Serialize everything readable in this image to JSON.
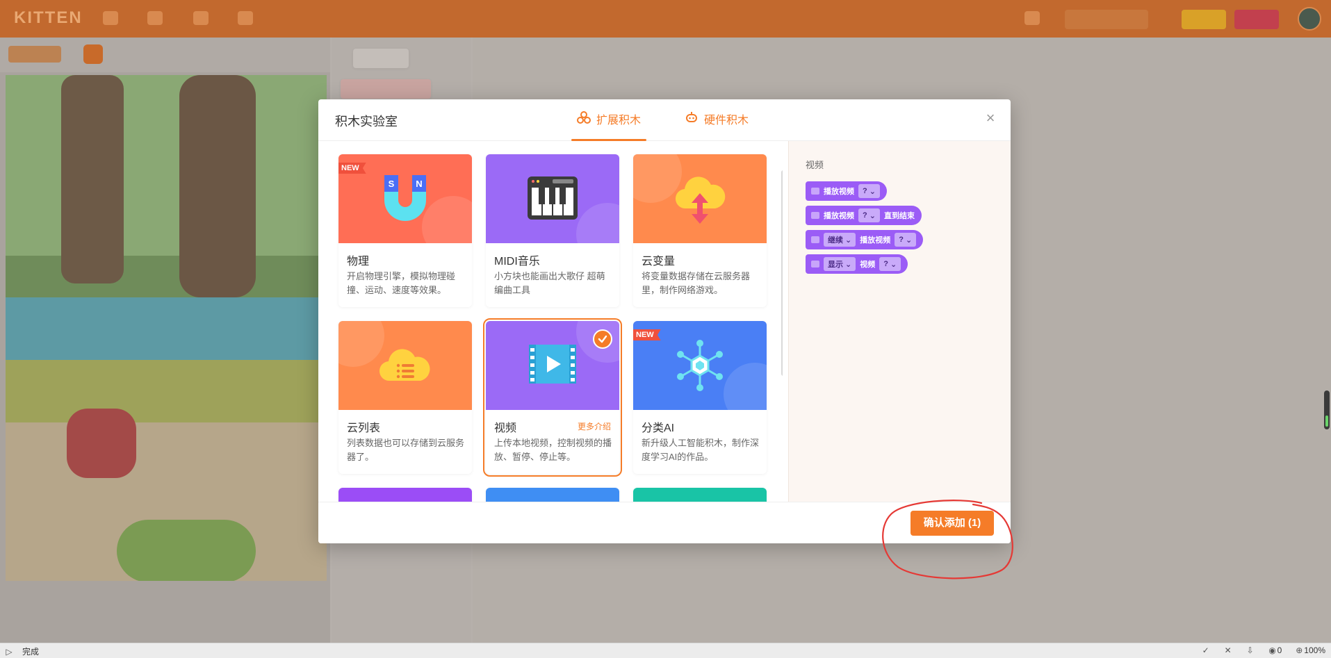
{
  "app": {
    "logo": "KITTEN",
    "status_text": "完成",
    "zoom": "100%",
    "counter": "0"
  },
  "modal": {
    "title": "积木实验室",
    "tabs": [
      {
        "label": "扩展积木",
        "icon": "extension-icon",
        "active": true
      },
      {
        "label": "硬件积木",
        "icon": "hardware-icon",
        "active": false
      }
    ],
    "close_label": "×",
    "confirm_label": "确认添加 (1)"
  },
  "cards": [
    {
      "name": "物理",
      "desc": "开启物理引擎，模拟物理碰撞、运动、速度等效果。",
      "badge": "NEW",
      "color": "#ff6e55",
      "icon": "magnet-icon",
      "selected": false
    },
    {
      "name": "MIDI音乐",
      "desc": "小方块也能画出大歌仔 超萌编曲工具",
      "badge": "",
      "color": "#9b6af6",
      "icon": "piano-icon",
      "selected": false
    },
    {
      "name": "云变量",
      "desc": "将变量数据存储在云服务器里，制作网络游戏。",
      "badge": "",
      "color": "#ff8a4d",
      "icon": "cloud-upload-icon",
      "selected": false
    },
    {
      "name": "云列表",
      "desc": "列表数据也可以存储到云服务器了。",
      "badge": "",
      "color": "#ff8a4d",
      "icon": "cloud-list-icon",
      "selected": false
    },
    {
      "name": "视频",
      "desc": "上传本地视频，控制视频的播放、暂停、停止等。",
      "badge": "",
      "color": "#9b6af6",
      "icon": "video-icon",
      "selected": true,
      "more": "更多介绍"
    },
    {
      "name": "分类AI",
      "desc": "新升级人工智能积木，制作深度学习AI的作品。",
      "badge": "NEW",
      "color": "#4a7ff5",
      "icon": "ai-network-icon",
      "selected": false
    }
  ],
  "partial_cards": [
    {
      "color": "#9b4df6"
    },
    {
      "color": "#3f8ef3"
    },
    {
      "color": "#19c4a6"
    }
  ],
  "preview": {
    "title": "视频",
    "blocks": [
      {
        "parts": [
          "播放视频"
        ],
        "drops": [
          "?"
        ],
        "suffix": ""
      },
      {
        "parts": [
          "播放视频"
        ],
        "drops": [
          "?"
        ],
        "suffix": "直到结束"
      },
      {
        "parts": [
          "继续",
          "播放视频"
        ],
        "drops": [
          "?"
        ],
        "prefix_drop": true,
        "suffix": ""
      },
      {
        "parts": [
          "显示",
          "视频"
        ],
        "drops": [
          "?"
        ],
        "prefix_drop": true,
        "suffix": ""
      }
    ]
  }
}
